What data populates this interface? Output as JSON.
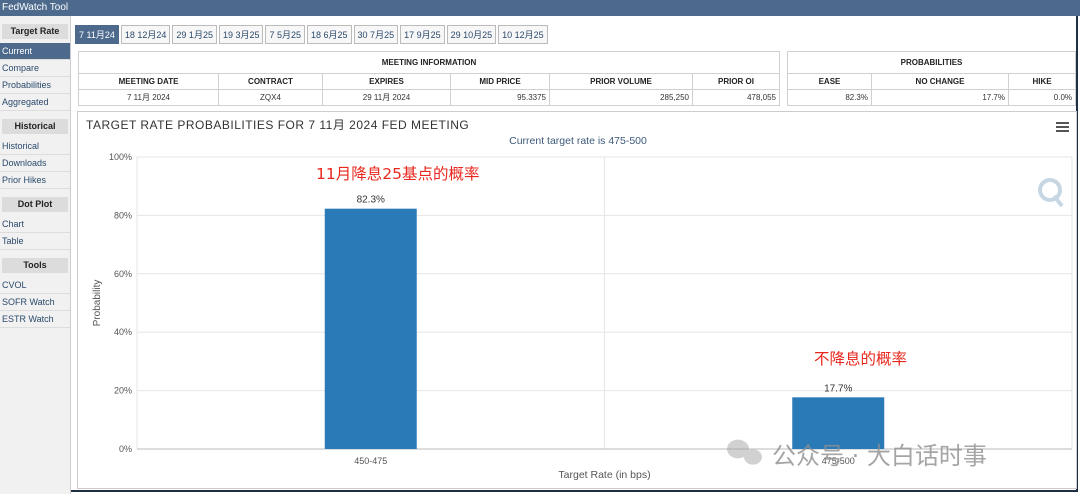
{
  "app": {
    "title": "FedWatch Tool"
  },
  "sidebar": {
    "sections": [
      {
        "heading": "Target Rate",
        "items": [
          "Current",
          "Compare",
          "Probabilities",
          "Aggregated"
        ]
      },
      {
        "heading": "Historical",
        "items": [
          "Historical",
          "Downloads",
          "Prior Hikes"
        ]
      },
      {
        "heading": "Dot Plot",
        "items": [
          "Chart",
          "Table"
        ]
      },
      {
        "heading": "Tools",
        "items": [
          "CVOL",
          "SOFR Watch",
          "ESTR Watch"
        ]
      }
    ],
    "active_item": "Current"
  },
  "tabs": [
    "7 11月24",
    "18 12月24",
    "29 1月25",
    "19 3月25",
    "7 5月25",
    "18 6月25",
    "30 7月25",
    "17 9月25",
    "29 10月25",
    "10 12月25"
  ],
  "meeting_info": {
    "section_title": "MEETING INFORMATION",
    "headers": [
      "MEETING DATE",
      "CONTRACT",
      "EXPIRES",
      "MID PRICE",
      "PRIOR VOLUME",
      "PRIOR OI"
    ],
    "values": [
      "7 11月 2024",
      "ZQX4",
      "29 11月 2024",
      "95.3375",
      "285,250",
      "478,055"
    ]
  },
  "probabilities": {
    "section_title": "PROBABILITIES",
    "headers": [
      "EASE",
      "NO CHANGE",
      "HIKE"
    ],
    "values": [
      "82.3%",
      "17.7%",
      "0.0%"
    ]
  },
  "chart": {
    "menu_icon": "hamburger-menu-icon",
    "watermark_icon": "q-logo-icon",
    "bar_color": "#2a7ab7",
    "annotation_color": "#e8281e",
    "annotations": {
      "left": "11月降息25基点的概率",
      "right": "不降息的概率"
    },
    "watermark_text": "公众号 · 大白话时事"
  },
  "chart_data": {
    "type": "bar",
    "title": "TARGET RATE PROBABILITIES FOR 7 11月 2024 FED MEETING",
    "subtitle": "Current target rate is 475-500",
    "xlabel": "Target Rate (in bps)",
    "ylabel": "Probability",
    "categories": [
      "450-475",
      "475-500"
    ],
    "values": [
      82.3,
      17.7
    ],
    "data_labels": [
      "82.3%",
      "17.7%"
    ],
    "ylim": [
      0,
      100
    ],
    "yticks": [
      "0%",
      "20%",
      "40%",
      "60%",
      "80%",
      "100%"
    ],
    "grid": true
  }
}
